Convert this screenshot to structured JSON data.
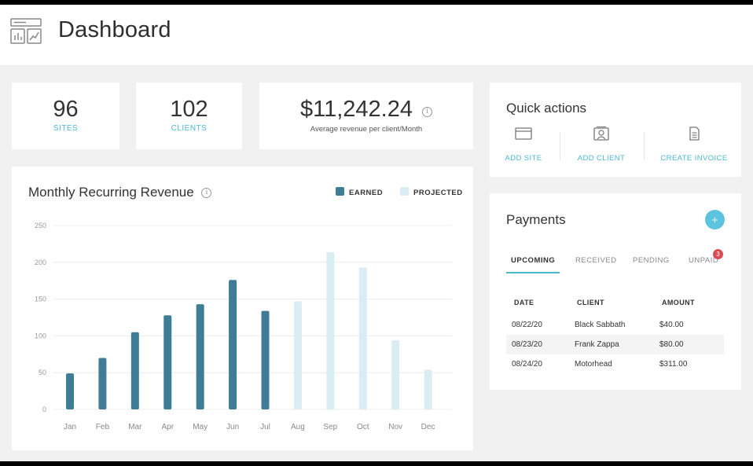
{
  "header": {
    "title": "Dashboard",
    "icon": "dashboard-icon"
  },
  "stats": {
    "sites": {
      "value": "96",
      "label": "SITES"
    },
    "clients": {
      "value": "102",
      "label": "CLIENTS"
    },
    "revenue": {
      "value": "$11,242.24",
      "label": "Average revenue per client/Month",
      "info": "i"
    }
  },
  "revenue_chart": {
    "title": "Monthly Recurring Revenue",
    "info": "i",
    "legend": {
      "earned": "EARNED",
      "projected": "PROJECTED"
    }
  },
  "quick_actions": {
    "title": "Quick actions",
    "items": [
      {
        "label": "ADD SITE",
        "icon": "browser-window-icon"
      },
      {
        "label": "ADD CLIENT",
        "icon": "client-id-card-icon"
      },
      {
        "label": "CREATE INVOICE",
        "icon": "invoice-document-icon"
      }
    ]
  },
  "payments": {
    "title": "Payments",
    "add_label": "+",
    "tabs": [
      "UPCOMING",
      "RECEIVED",
      "PENDING",
      "UNPAID"
    ],
    "active_tab": "UPCOMING",
    "unpaid_count": "3",
    "columns": [
      "DATE",
      "CLIENT",
      "AMOUNT"
    ],
    "rows": [
      {
        "date": "08/22/20",
        "client": "Black Sabbath",
        "amount": "$40.00"
      },
      {
        "date": "08/23/20",
        "client": "Frank Zappa",
        "amount": "$80.00"
      },
      {
        "date": "08/24/20",
        "client": "Motorhead",
        "amount": "$311.00"
      }
    ]
  },
  "colors": {
    "earned": "#3f7d97",
    "projected": "#d9edf3",
    "accent": "#4db8d4",
    "badge": "#d94b55"
  },
  "chart_data": {
    "type": "bar",
    "title": "Monthly Recurring Revenue",
    "categories": [
      "Jan",
      "Feb",
      "Mar",
      "Apr",
      "May",
      "Jun",
      "Jul",
      "Aug",
      "Sep",
      "Oct",
      "Nov",
      "Dec"
    ],
    "series": [
      {
        "name": "EARNED",
        "values": [
          49,
          70,
          105,
          128,
          143,
          176,
          134,
          null,
          null,
          null,
          null,
          null
        ]
      },
      {
        "name": "PROJECTED",
        "values": [
          null,
          null,
          null,
          null,
          null,
          null,
          null,
          147,
          214,
          193,
          94,
          54
        ]
      }
    ],
    "yticks": [
      0,
      50,
      100,
      150,
      200,
      250
    ],
    "ylim": [
      0,
      250
    ],
    "grid": true,
    "legend_position": "top-right"
  }
}
